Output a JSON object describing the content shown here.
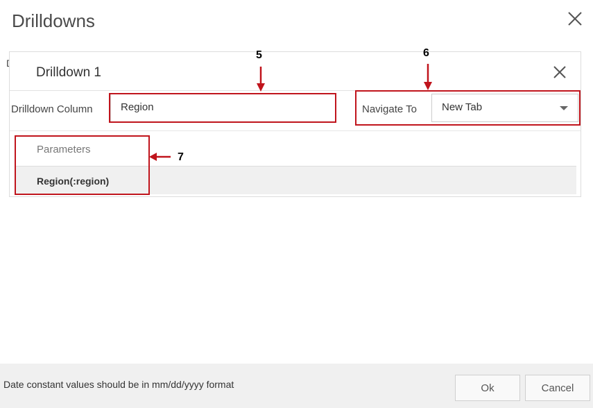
{
  "dialog": {
    "title": "Drilldowns",
    "close_icon": "close-icon",
    "partial_letter": "D"
  },
  "drilldown": {
    "title": "Drilldown 1",
    "close_icon": "close-icon",
    "column_label": "Drilldown Column",
    "column_value": "Region",
    "navigate_label": "Navigate To",
    "navigate_value": "New Tab",
    "navigate_icon": "chevron-down-icon",
    "parameters_header": "Parameters",
    "parameters": [
      "Region(:region)"
    ]
  },
  "annotations": {
    "marker_5": "5",
    "marker_6": "6",
    "marker_7": "7",
    "color": "#c0141c"
  },
  "footer": {
    "note": "Date constant values should be in mm/dd/yyyy format",
    "ok_label": "Ok",
    "cancel_label": "Cancel"
  }
}
